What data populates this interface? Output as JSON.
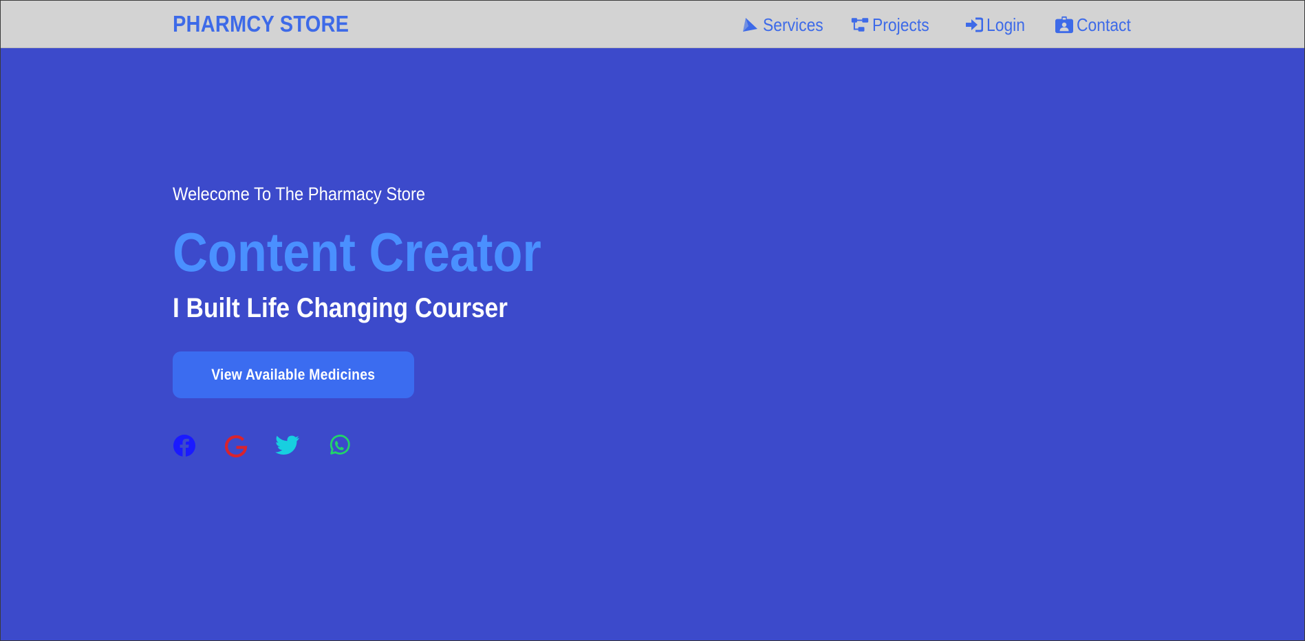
{
  "colors": {
    "page_background": "#3c4acb",
    "navbar_background": "#d3d3d3",
    "brand": "#3d6ae8",
    "nav_link": "#3d6ae8",
    "headline": "#4a90ff",
    "button_background": "#3b6cf0",
    "text_light": "#ffffff",
    "facebook": "#1a1aff",
    "google": "#d9232e",
    "twitter": "#17cfe0",
    "whatsapp": "#22d36a"
  },
  "navbar": {
    "brand": "PHARMCY STORE",
    "links": [
      {
        "label": "Services",
        "icon": "paper-plane-icon"
      },
      {
        "label": "Projects",
        "icon": "sitemap-icon"
      },
      {
        "label": "Login",
        "icon": "sign-in-icon"
      },
      {
        "label": "Contact",
        "icon": "id-badge-icon"
      }
    ]
  },
  "hero": {
    "welcome": "Welecome To The Pharmacy Store",
    "headline": "Content Creator",
    "subheadline": "I Built Life Changing Courser",
    "cta_label": "View Available Medicines"
  },
  "socials": [
    {
      "name": "Facebook",
      "icon": "facebook-icon"
    },
    {
      "name": "Google",
      "icon": "google-icon"
    },
    {
      "name": "Twitter",
      "icon": "twitter-icon"
    },
    {
      "name": "WhatsApp",
      "icon": "whatsapp-icon"
    }
  ]
}
